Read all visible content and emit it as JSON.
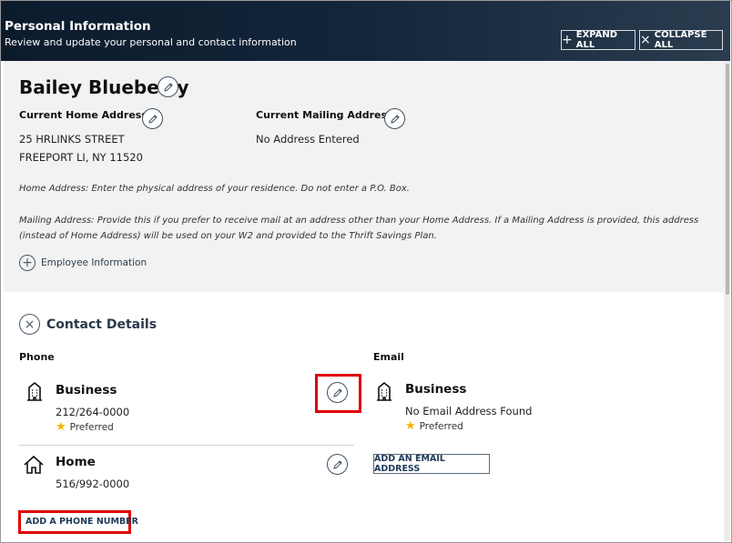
{
  "header": {
    "title": "Personal Information",
    "subtitle": "Review and update your personal and contact information",
    "expand_all": "EXPAND ALL",
    "collapse_all": "COLLAPSE ALL"
  },
  "profile": {
    "name": "Bailey Blueberry",
    "home_address_label": "Current Home Address",
    "home_address_line1": "25 HRLINKS STREET",
    "home_address_line2": "FREEPORT LI, NY 11520",
    "mailing_address_label": "Current Mailing Address",
    "mailing_address_value": "No Address Entered",
    "home_note": "Home Address: Enter the physical address of your residence. Do not enter a P.O. Box.",
    "mailing_note": "Mailing Address: Provide this if you prefer to receive mail at an address other than your Home Address. If a Mailing Address is provided, this address (instead of Home Address) will be used on your W2 and provided to the Thrift Savings Plan.",
    "employee_info_label": "Employee Information"
  },
  "contact": {
    "section_title": "Contact Details",
    "phone_label": "Phone",
    "email_label": "Email",
    "phones": [
      {
        "type": "Business",
        "number": "212/264-0000",
        "preferred": "Preferred"
      },
      {
        "type": "Home",
        "number": "516/992-0000"
      }
    ],
    "emails": [
      {
        "type": "Business",
        "value": "No Email Address Found",
        "preferred": "Preferred"
      }
    ],
    "add_phone": "ADD A PHONE NUMBER",
    "add_email": "ADD AN EMAIL ADDRESS"
  },
  "colors": {
    "header_bg": "#13263a",
    "highlight": "#e00000",
    "star": "#f4b400"
  }
}
